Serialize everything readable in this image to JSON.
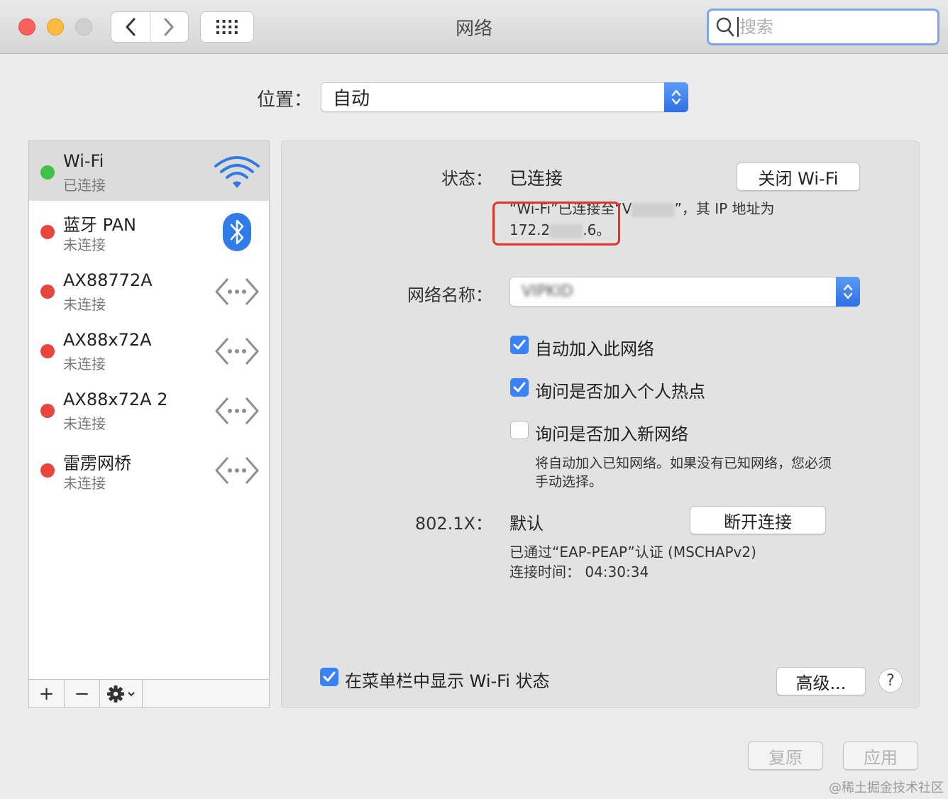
{
  "window": {
    "title": "网络",
    "search_placeholder": "搜索"
  },
  "location": {
    "label": "位置：",
    "value": "自动"
  },
  "services": [
    {
      "name": "Wi-Fi",
      "status": "已连接",
      "state": "connected",
      "icon": "wifi-icon",
      "selected": true
    },
    {
      "name": "蓝牙 PAN",
      "status": "未连接",
      "state": "disconnected",
      "icon": "bluetooth-icon"
    },
    {
      "name": "AX88772A",
      "status": "未连接",
      "state": "disconnected",
      "icon": "ethernet-icon"
    },
    {
      "name": "AX88x72A",
      "status": "未连接",
      "state": "disconnected",
      "icon": "ethernet-icon"
    },
    {
      "name": "AX88x72A 2",
      "status": "未连接",
      "state": "disconnected",
      "icon": "ethernet-icon"
    },
    {
      "name": "雷雳网桥",
      "status": "未连接",
      "state": "disconnected",
      "icon": "ethernet-icon"
    }
  ],
  "sidebar_toolbar": {
    "add": "+",
    "remove": "−"
  },
  "detail": {
    "status_label": "状态：",
    "status_value": "已连接",
    "toggle_wifi_button": "关闭 Wi-Fi",
    "status_desc_line1_prefix": "“Wi-Fi”已连接至“V",
    "status_desc_line1_suffix": "”，其 IP 地址为",
    "status_desc_line2_prefix": "172.2",
    "status_desc_line2_suffix": ".6。",
    "network_name_label": "网络名称：",
    "network_name_value": "VIPKID",
    "checkboxes": [
      {
        "label": "自动加入此网络",
        "checked": true
      },
      {
        "label": "询问是否加入个人热点",
        "checked": true
      },
      {
        "label": "询问是否加入新网络",
        "checked": false
      }
    ],
    "ask_note_line1": "将自动加入已知网络。如果没有已知网络，您必须",
    "ask_note_line2": "手动选择。",
    "dot1x_label": "802.1X：",
    "dot1x_value": "默认",
    "disconnect_button": "断开连接",
    "auth_line": "已通过“EAP-PEAP”认证 (MSCHAPv2)",
    "connect_time_line": "连接时间：  04:30:34",
    "show_in_menubar_label": "在菜单栏中显示 Wi-Fi 状态",
    "show_in_menubar_checked": true,
    "advanced_button": "高级...",
    "help_button": "?"
  },
  "footer": {
    "revert_button": "复原",
    "apply_button": "应用"
  },
  "watermark": "@稀土掘金技术社区",
  "colors": {
    "accent": "#3a82f7",
    "connected": "#3fc14a",
    "disconnected": "#e8453c",
    "highlight_box": "#e0332a"
  }
}
